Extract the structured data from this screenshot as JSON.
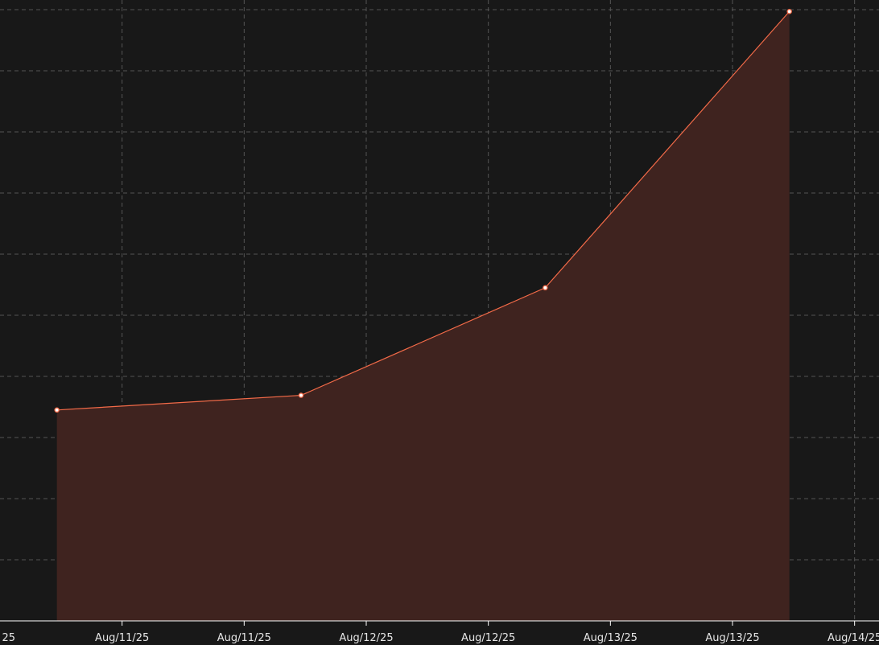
{
  "chart_data": {
    "type": "area",
    "title": "",
    "xlabel": "",
    "ylabel": "",
    "x_tick_labels": [
      "25",
      "Aug/11/25",
      "Aug/11/25",
      "Aug/12/25",
      "Aug/12/25",
      "Aug/13/25",
      "Aug/13/25",
      "Aug/14/25"
    ],
    "x_ticks": [
      0.0,
      0.5,
      1.0,
      1.5,
      2.0,
      2.5,
      3.0,
      3.5
    ],
    "xlim": [
      0.0,
      3.6
    ],
    "ylim": [
      0,
      10
    ],
    "y_ticks": [
      0,
      1,
      2,
      3,
      4,
      5,
      6,
      7,
      8,
      9,
      10
    ],
    "grid": true,
    "legend": "none",
    "series": [
      {
        "x": [
          0.233,
          1.233,
          2.233,
          3.233
        ],
        "values": [
          3.45,
          3.69,
          5.45,
          9.97
        ],
        "color": "#f26a48",
        "fill": "#3f231f"
      }
    ],
    "colors": {
      "background": "#181818",
      "grid": "#555555",
      "axis": "#ffffff",
      "text": "#e6e6e6",
      "marker_fill": "#ffffff"
    }
  }
}
